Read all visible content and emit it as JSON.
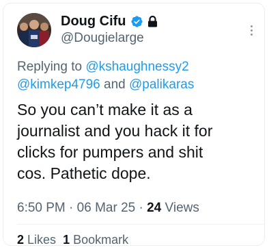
{
  "tweet": {
    "display_name": "Doug Cifu",
    "handle": "@Dougielarge",
    "verified_icon": "verified-badge-icon",
    "lock_icon": "lock-icon",
    "replying_to_prefix": "Replying to",
    "mentions": [
      "@kshaughnessy2",
      "@kimkep4796",
      "@palikaras"
    ],
    "mention_joiner": "and",
    "text": "So you can’t make it as a\njournalist and you hack it for\nclicks for pumpers and shit\ncos.   Pathetic dope.",
    "time": "6:50 PM",
    "date": "06 Mar 25",
    "separator": "·",
    "views_count": "24",
    "views_label": "Views",
    "likes_count": "2",
    "likes_label": "Likes",
    "bookmarks_count": "1",
    "bookmarks_label": "Bookmark"
  },
  "colors": {
    "text": "#0f1419",
    "secondary": "#536471",
    "accent": "#1d9bf0"
  }
}
